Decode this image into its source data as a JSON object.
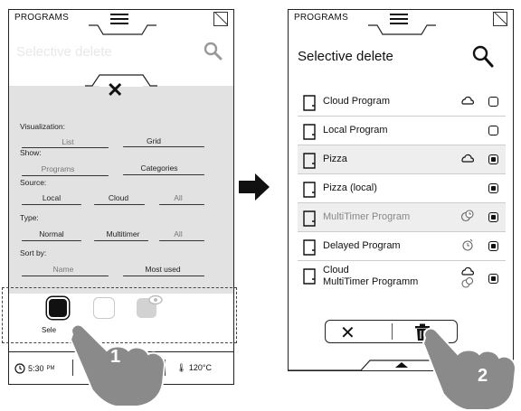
{
  "left_screen": {
    "header_label": "PROGRAMS",
    "title": "Selective delete",
    "filter_panel": {
      "visualization": {
        "label": "Visualization:",
        "options": [
          "List",
          "Grid"
        ]
      },
      "show": {
        "label": "Show:",
        "options": [
          "Programs",
          "Categories"
        ]
      },
      "source": {
        "label": "Source:",
        "options": [
          "Local",
          "Cloud",
          "All"
        ]
      },
      "type": {
        "label": "Type:",
        "options": [
          "Normal",
          "Multitimer",
          "All"
        ]
      },
      "sort_by": {
        "label": "Sort by:",
        "options": [
          "Name",
          "Most used"
        ]
      }
    },
    "select_label": "Sele",
    "status_bar": {
      "time": "5:30",
      "time_suffix": "PM",
      "temperature": "120°C"
    }
  },
  "right_screen": {
    "header_label": "PROGRAMS",
    "title": "Selective delete",
    "programs": [
      {
        "name": "Cloud Program",
        "icon": "cloud-icon",
        "checked": false,
        "dim": false
      },
      {
        "name": "Local Program",
        "icon": "",
        "checked": false,
        "dim": false
      },
      {
        "name": "Pizza",
        "icon": "cloud-icon",
        "checked": true,
        "dim": false
      },
      {
        "name": "Pizza (local)",
        "icon": "",
        "checked": true,
        "dim": false
      },
      {
        "name": "MultiTimer Program",
        "icon": "multitimer-icon",
        "checked": true,
        "dim": true
      },
      {
        "name": "Delayed Program",
        "icon": "delay-timer-icon",
        "checked": true,
        "dim": false
      },
      {
        "name_line1": "Cloud",
        "name_line2": "MultiTimer Programm",
        "icon": "cloud-multitimer-icon",
        "checked": true,
        "dim": false
      }
    ]
  },
  "steps": {
    "step1": "1",
    "step2": "2"
  },
  "colors": {
    "panel": "#e2e2e2",
    "ink": "#111111",
    "hand": "#8a8a8a"
  }
}
